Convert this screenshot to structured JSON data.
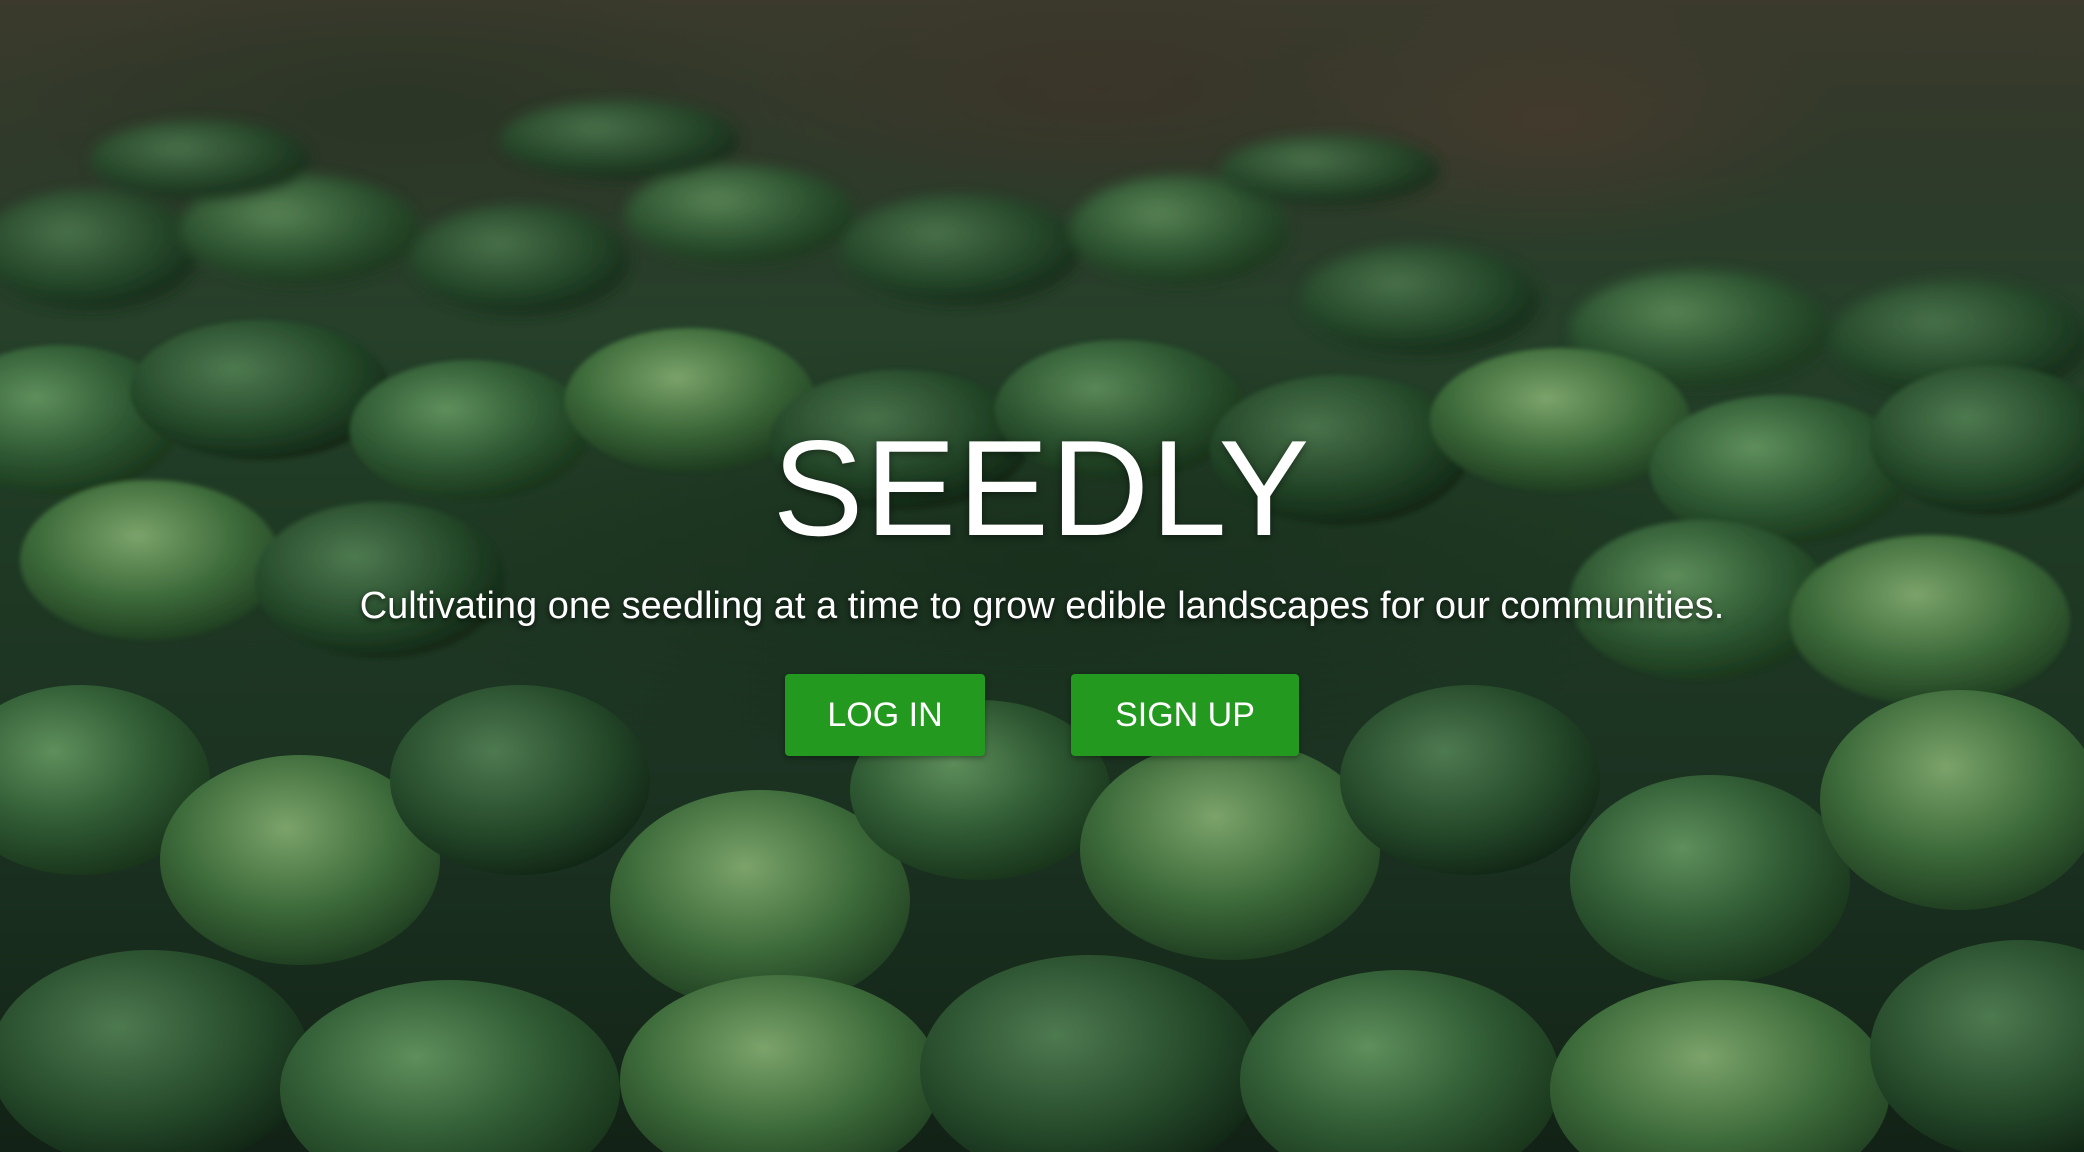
{
  "hero": {
    "brand": "SEEDLY",
    "tagline": "Cultivating one seedling at a time to grow edible landscapes for our communities.",
    "background_image": "leafy-greens-field"
  },
  "actions": {
    "login_label": "LOG IN",
    "signup_label": "SIGN UP"
  },
  "colors": {
    "button_bg": "#23991f",
    "text": "#ffffff"
  }
}
